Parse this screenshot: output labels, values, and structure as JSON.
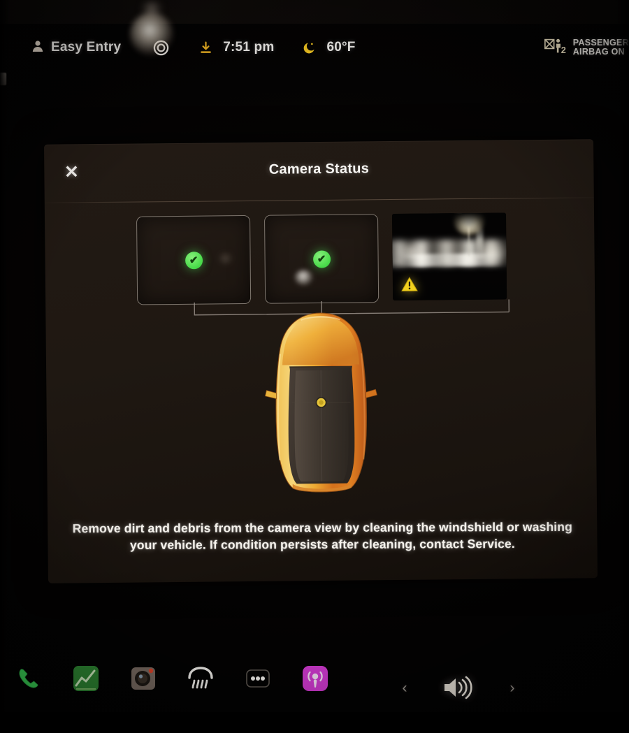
{
  "status_bar": {
    "profile": {
      "icon": "person-icon",
      "label": "Easy Entry"
    },
    "lock_icon": "circle-target-icon",
    "download_icon": "download-arrow-icon",
    "time": "7:51 pm",
    "weather_icon": "moon-icon",
    "temperature": "60°F",
    "airbag": {
      "icon": "passenger-airbag-icon",
      "line1": "PASSENGER",
      "line2": "AIRBAG ON"
    }
  },
  "dialog": {
    "title": "Camera Status",
    "close_icon": "close-icon",
    "close_label": "✕",
    "instruction": "Remove dirt and debris from the camera view by cleaning the windshield or washing your vehicle. If condition persists after cleaning, contact Service.",
    "cameras": [
      {
        "name": "left-camera",
        "state": "ok",
        "badge_icon": "check-circle-icon",
        "badge_glyph": "✔",
        "preview": "dark"
      },
      {
        "name": "main-camera",
        "state": "ok",
        "badge_icon": "check-circle-icon",
        "badge_glyph": "✔",
        "preview": "dark-with-smudge"
      },
      {
        "name": "right-camera",
        "state": "warning",
        "badge_icon": "warning-triangle-icon",
        "badge_glyph": "!",
        "preview": "night-view-blurred"
      }
    ],
    "vehicle_icon": "vehicle-top-view"
  },
  "taskbar": {
    "apps": [
      {
        "name": "phone-app",
        "icon": "phone-icon",
        "color": "#3ddc5a"
      },
      {
        "name": "stocks-app",
        "icon": "chart-icon",
        "color": "#3fa83f"
      },
      {
        "name": "dashcam-app",
        "icon": "camera-icon",
        "color": "#8d7f76"
      },
      {
        "name": "defrost-button",
        "icon": "rear-defrost-icon",
        "color": "#f4f2ee"
      },
      {
        "name": "more-apps-button",
        "icon": "ellipsis-icon",
        "color": "#f4f2ee"
      },
      {
        "name": "podcasts-app",
        "icon": "podcast-icon",
        "color": "#d13ad1"
      }
    ],
    "media": {
      "previous_label": "‹",
      "next_label": "›",
      "volume_icon": "volume-icon"
    }
  },
  "colors": {
    "accent_green": "#4ddc4d",
    "accent_warning": "#f2d11e",
    "dialog_bg": "#1f1812",
    "vehicle_body": "#e8922a"
  }
}
